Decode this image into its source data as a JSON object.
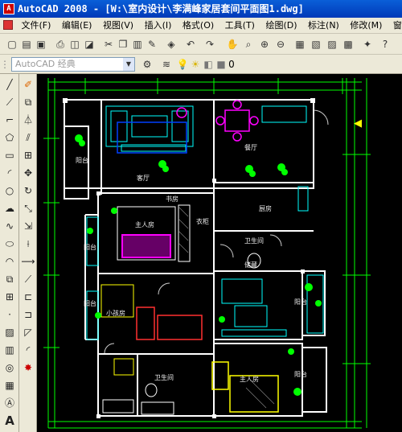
{
  "window": {
    "title": "AutoCAD 2008 - [W:\\室内设计\\李满峰家居套间平面图1.dwg]",
    "icon_label": "A"
  },
  "menubar": {
    "items": [
      "文件(F)",
      "编辑(E)",
      "视图(V)",
      "插入(I)",
      "格式(O)",
      "工具(T)",
      "绘图(D)",
      "标注(N)",
      "修改(M)",
      "窗口(W)"
    ]
  },
  "workspace": {
    "current": "AutoCAD 经典"
  },
  "layer": {
    "name": "0"
  },
  "left_toolbar": {
    "text_tool": "A"
  },
  "drawing": {
    "rooms": {
      "balcony_1": "阳台",
      "living_room": "客厅",
      "dining": "餐厅",
      "kitchen": "厨房",
      "master_bedroom": "主人房",
      "closet": "衣柜",
      "balcony_2": "阳台",
      "balcony_3": "阳台",
      "kids_room": "小孩房",
      "guest_bath": "卫生间",
      "bath_1": "卫生间",
      "master_suite": "主人房",
      "balcony_4": "阳台",
      "balcony_5": "阳台",
      "study": "书房",
      "storage": "储藏"
    }
  },
  "colors": {
    "wall": "#ffffff",
    "furniture_cyan": "#00ffff",
    "plant_green": "#00ff00",
    "magenta": "#ff00ff",
    "yellow": "#ffff00",
    "dim_line": "#00ff00",
    "red": "#ff3030"
  }
}
